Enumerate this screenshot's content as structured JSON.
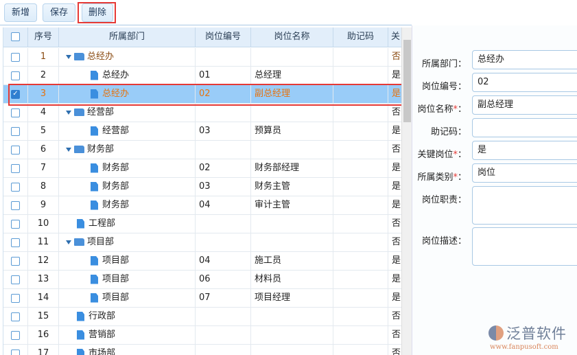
{
  "toolbar": {
    "add": "新增",
    "save": "保存",
    "delete": "删除"
  },
  "grid": {
    "headers": [
      "序号",
      "所属部门",
      "岗位编号",
      "岗位名称",
      "助记码",
      "关"
    ],
    "rows": [
      {
        "no": "1",
        "dept": "总经办",
        "level": 0,
        "type": "folder",
        "code": "",
        "name": "",
        "mnemonic": "",
        "key": "否"
      },
      {
        "no": "2",
        "dept": "总经办",
        "level": 1,
        "type": "file",
        "code": "01",
        "name": "总经理",
        "mnemonic": "",
        "key": "是"
      },
      {
        "no": "3",
        "dept": "总经办",
        "level": 1,
        "type": "file",
        "code": "02",
        "name": "副总经理",
        "mnemonic": "",
        "key": "是",
        "selected": true
      },
      {
        "no": "4",
        "dept": "经营部",
        "level": 0,
        "type": "folder",
        "code": "",
        "name": "",
        "mnemonic": "",
        "key": "否"
      },
      {
        "no": "5",
        "dept": "经营部",
        "level": 1,
        "type": "file",
        "code": "03",
        "name": "预算员",
        "mnemonic": "",
        "key": "是"
      },
      {
        "no": "6",
        "dept": "财务部",
        "level": 0,
        "type": "folder",
        "code": "",
        "name": "",
        "mnemonic": "",
        "key": "否"
      },
      {
        "no": "7",
        "dept": "财务部",
        "level": 1,
        "type": "file",
        "code": "02",
        "name": "财务部经理",
        "mnemonic": "",
        "key": "是"
      },
      {
        "no": "8",
        "dept": "财务部",
        "level": 1,
        "type": "file",
        "code": "03",
        "name": "财务主管",
        "mnemonic": "",
        "key": "是"
      },
      {
        "no": "9",
        "dept": "财务部",
        "level": 1,
        "type": "file",
        "code": "04",
        "name": "审计主管",
        "mnemonic": "",
        "key": "是"
      },
      {
        "no": "10",
        "dept": "工程部",
        "level": 0,
        "type": "file",
        "code": "",
        "name": "",
        "mnemonic": "",
        "key": "否"
      },
      {
        "no": "11",
        "dept": "项目部",
        "level": 0,
        "type": "folder",
        "code": "",
        "name": "",
        "mnemonic": "",
        "key": "否"
      },
      {
        "no": "12",
        "dept": "项目部",
        "level": 1,
        "type": "file",
        "code": "04",
        "name": "施工员",
        "mnemonic": "",
        "key": "是"
      },
      {
        "no": "13",
        "dept": "项目部",
        "level": 1,
        "type": "file",
        "code": "06",
        "name": "材料员",
        "mnemonic": "",
        "key": "是"
      },
      {
        "no": "14",
        "dept": "项目部",
        "level": 1,
        "type": "file",
        "code": "07",
        "name": "项目经理",
        "mnemonic": "",
        "key": "是"
      },
      {
        "no": "15",
        "dept": "行政部",
        "level": 0,
        "type": "file",
        "code": "",
        "name": "",
        "mnemonic": "",
        "key": "否"
      },
      {
        "no": "16",
        "dept": "营销部",
        "level": 0,
        "type": "file",
        "code": "",
        "name": "",
        "mnemonic": "",
        "key": "否"
      },
      {
        "no": "17",
        "dept": "市场部",
        "level": 0,
        "type": "file",
        "code": "",
        "name": "",
        "mnemonic": "",
        "key": "否"
      }
    ]
  },
  "form": {
    "fields": [
      {
        "label": "所属部门",
        "required": false,
        "value": "总经办"
      },
      {
        "label": "岗位编号",
        "required": false,
        "value": "02"
      },
      {
        "label": "岗位名称",
        "required": true,
        "value": "副总经理"
      },
      {
        "label": "助记码",
        "required": false,
        "value": ""
      },
      {
        "label": "关键岗位",
        "required": true,
        "value": "是"
      },
      {
        "label": "所属类别",
        "required": true,
        "value": "岗位"
      },
      {
        "label": "岗位职责",
        "required": false,
        "value": ""
      },
      {
        "label": "岗位描述",
        "required": false,
        "value": ""
      }
    ]
  },
  "logo": {
    "name": "泛普软件",
    "url": "www.fanpusoft.com"
  }
}
